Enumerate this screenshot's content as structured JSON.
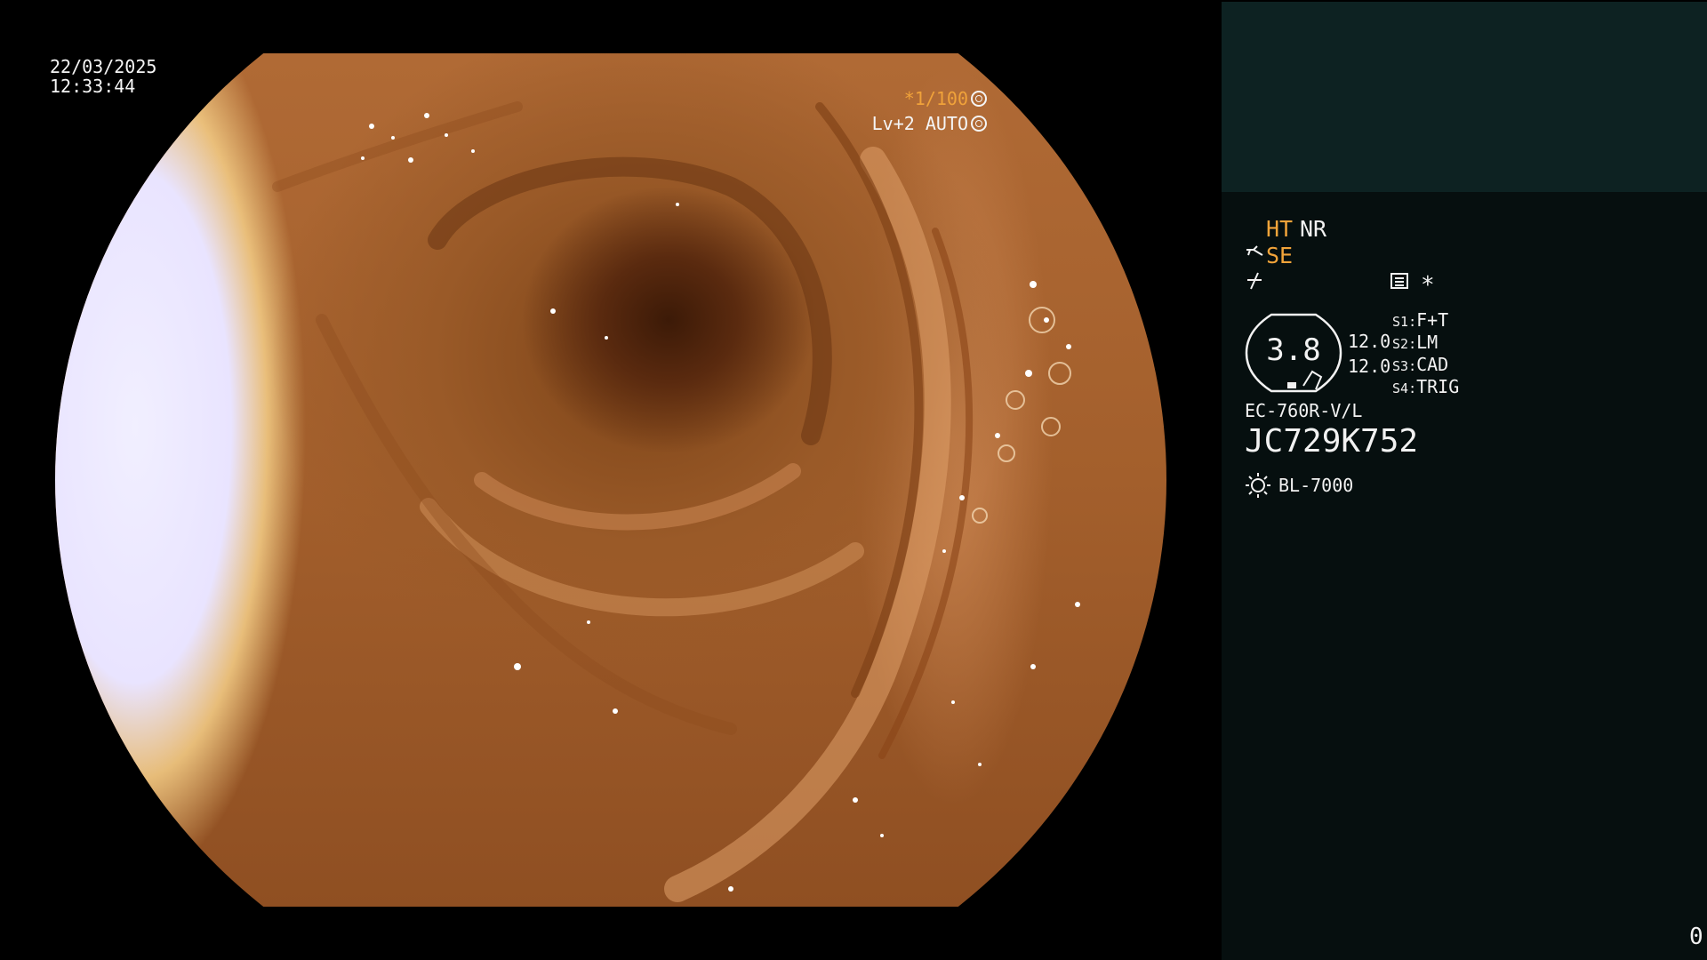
{
  "overlay": {
    "date": "22/03/2025",
    "time": "12:33:44",
    "shutter": "*1/100",
    "level": "Lv+2",
    "exposure_mode": "AUTO"
  },
  "panel": {
    "ht_label": "HT",
    "nr_label": "NR",
    "se_label": "SE",
    "star_label": "*",
    "lens_value": "3.8",
    "lens_value_left": "12.0",
    "lens_value_right": "12.0",
    "slots": [
      {
        "key": "S1",
        "value": "F+T"
      },
      {
        "key": "S2",
        "value": "LM"
      },
      {
        "key": "S3",
        "value": "CAD"
      },
      {
        "key": "S4",
        "value": "TRIG"
      }
    ],
    "scope_model": "EC-760R-V/L",
    "serial_number": "JC729K752",
    "light_source": "BL-7000",
    "counter": "0"
  },
  "icons": {
    "shutter_icon": "aperture-icon",
    "mode_icon": "iris-icon",
    "se_icon": "scope-tip-icon",
    "slash_icon": "signal-off-icon",
    "menu_icon": "menu-icon",
    "lens_icon": "lens-frame-icon",
    "light_icon": "sun-icon"
  },
  "colors": {
    "accent_orange": "#f2a43a",
    "panel_top": "#0d2222",
    "panel_bottom": "#060f0f"
  }
}
